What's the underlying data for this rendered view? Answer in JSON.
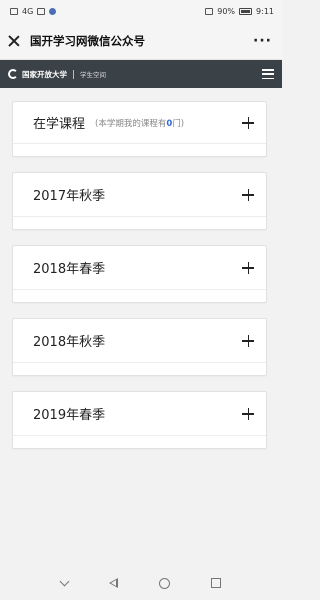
{
  "status_bar": {
    "carrier": "4G",
    "battery": "90%",
    "time": "9:11"
  },
  "title_bar": {
    "title": "国开学习网微信公众号",
    "more": "···"
  },
  "site_header": {
    "logo_name": "国家开放大学",
    "logo_sub": "学生空间"
  },
  "panels": [
    {
      "title": "在学课程",
      "note_prefix": "(本学期我的课程有",
      "count": "0",
      "note_suffix": "门)"
    },
    {
      "title": "2017年秋季"
    },
    {
      "title": "2018年春季"
    },
    {
      "title": "2018年秋季"
    },
    {
      "title": "2019年春季"
    }
  ],
  "icons": {
    "close": "close-icon",
    "more": "more-icon",
    "menu": "hamburger-menu-icon",
    "expand": "plus-icon"
  }
}
